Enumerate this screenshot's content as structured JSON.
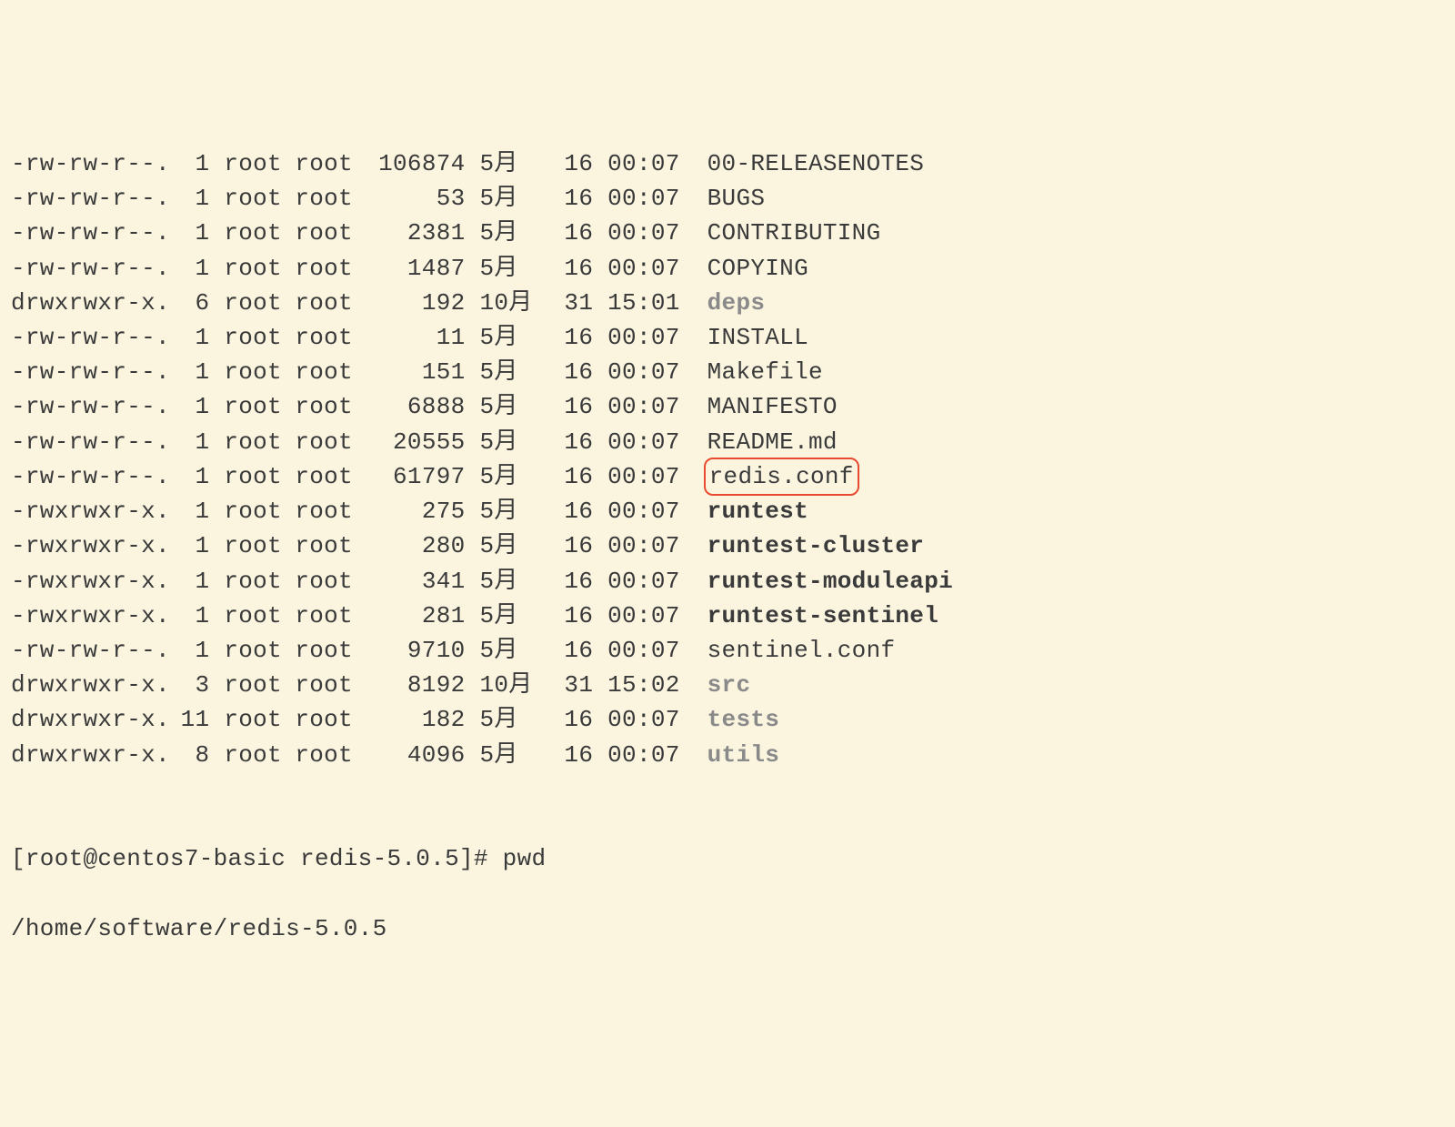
{
  "listing": [
    {
      "perms": "-rw-rw-r--.",
      "links": "1",
      "owner": "root",
      "group": "root",
      "size": "106874",
      "month": "5月",
      "day": "16",
      "time": "00:07",
      "name": "00-RELEASENOTES",
      "cls": "normal",
      "hl": false
    },
    {
      "perms": "-rw-rw-r--.",
      "links": "1",
      "owner": "root",
      "group": "root",
      "size": "53",
      "month": "5月",
      "day": "16",
      "time": "00:07",
      "name": "BUGS",
      "cls": "normal",
      "hl": false
    },
    {
      "perms": "-rw-rw-r--.",
      "links": "1",
      "owner": "root",
      "group": "root",
      "size": "2381",
      "month": "5月",
      "day": "16",
      "time": "00:07",
      "name": "CONTRIBUTING",
      "cls": "normal",
      "hl": false
    },
    {
      "perms": "-rw-rw-r--.",
      "links": "1",
      "owner": "root",
      "group": "root",
      "size": "1487",
      "month": "5月",
      "day": "16",
      "time": "00:07",
      "name": "COPYING",
      "cls": "normal",
      "hl": false
    },
    {
      "perms": "drwxrwxr-x.",
      "links": "6",
      "owner": "root",
      "group": "root",
      "size": "192",
      "month": "10月",
      "day": "31",
      "time": "15:01",
      "name": "deps",
      "cls": "dir",
      "hl": false
    },
    {
      "perms": "-rw-rw-r--.",
      "links": "1",
      "owner": "root",
      "group": "root",
      "size": "11",
      "month": "5月",
      "day": "16",
      "time": "00:07",
      "name": "INSTALL",
      "cls": "normal",
      "hl": false
    },
    {
      "perms": "-rw-rw-r--.",
      "links": "1",
      "owner": "root",
      "group": "root",
      "size": "151",
      "month": "5月",
      "day": "16",
      "time": "00:07",
      "name": "Makefile",
      "cls": "normal",
      "hl": false
    },
    {
      "perms": "-rw-rw-r--.",
      "links": "1",
      "owner": "root",
      "group": "root",
      "size": "6888",
      "month": "5月",
      "day": "16",
      "time": "00:07",
      "name": "MANIFESTO",
      "cls": "normal",
      "hl": false
    },
    {
      "perms": "-rw-rw-r--.",
      "links": "1",
      "owner": "root",
      "group": "root",
      "size": "20555",
      "month": "5月",
      "day": "16",
      "time": "00:07",
      "name": "README.md",
      "cls": "normal",
      "hl": false
    },
    {
      "perms": "-rw-rw-r--.",
      "links": "1",
      "owner": "root",
      "group": "root",
      "size": "61797",
      "month": "5月",
      "day": "16",
      "time": "00:07",
      "name": "redis.conf",
      "cls": "normal",
      "hl": true
    },
    {
      "perms": "-rwxrwxr-x.",
      "links": "1",
      "owner": "root",
      "group": "root",
      "size": "275",
      "month": "5月",
      "day": "16",
      "time": "00:07",
      "name": "runtest",
      "cls": "exec",
      "hl": false
    },
    {
      "perms": "-rwxrwxr-x.",
      "links": "1",
      "owner": "root",
      "group": "root",
      "size": "280",
      "month": "5月",
      "day": "16",
      "time": "00:07",
      "name": "runtest-cluster",
      "cls": "exec",
      "hl": false
    },
    {
      "perms": "-rwxrwxr-x.",
      "links": "1",
      "owner": "root",
      "group": "root",
      "size": "341",
      "month": "5月",
      "day": "16",
      "time": "00:07",
      "name": "runtest-moduleapi",
      "cls": "exec",
      "hl": false
    },
    {
      "perms": "-rwxrwxr-x.",
      "links": "1",
      "owner": "root",
      "group": "root",
      "size": "281",
      "month": "5月",
      "day": "16",
      "time": "00:07",
      "name": "runtest-sentinel",
      "cls": "exec",
      "hl": false
    },
    {
      "perms": "-rw-rw-r--.",
      "links": "1",
      "owner": "root",
      "group": "root",
      "size": "9710",
      "month": "5月",
      "day": "16",
      "time": "00:07",
      "name": "sentinel.conf",
      "cls": "normal",
      "hl": false
    },
    {
      "perms": "drwxrwxr-x.",
      "links": "3",
      "owner": "root",
      "group": "root",
      "size": "8192",
      "month": "10月",
      "day": "31",
      "time": "15:02",
      "name": "src",
      "cls": "dir",
      "hl": false
    },
    {
      "perms": "drwxrwxr-x.",
      "links": "11",
      "owner": "root",
      "group": "root",
      "size": "182",
      "month": "5月",
      "day": "16",
      "time": "00:07",
      "name": "tests",
      "cls": "dir",
      "hl": false
    },
    {
      "perms": "drwxrwxr-x.",
      "links": "8",
      "owner": "root",
      "group": "root",
      "size": "4096",
      "month": "5月",
      "day": "16",
      "time": "00:07",
      "name": "utils",
      "cls": "dir",
      "hl": false
    }
  ],
  "prompt_line": "[root@centos7-basic redis-5.0.5]# pwd",
  "pwd_output": "/home/software/redis-5.0.5"
}
